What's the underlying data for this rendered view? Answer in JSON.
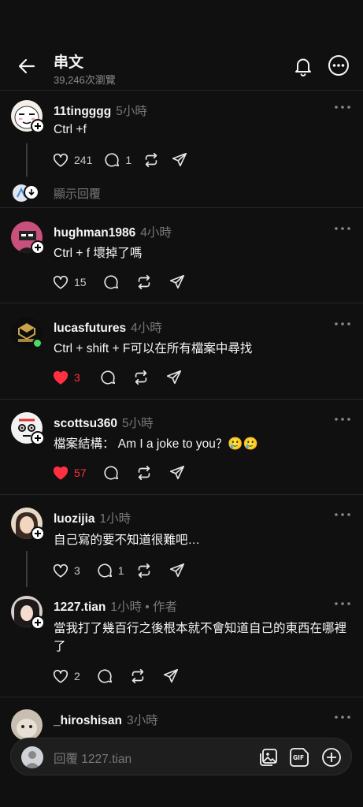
{
  "header": {
    "title": "串文",
    "views": "39,246次瀏覽"
  },
  "posts": [
    {
      "username": "11tingggg",
      "time": "5小時",
      "content": "Ctrl +f",
      "likes": "241",
      "replies": "1",
      "liked": false
    },
    {
      "username": "hughman1986",
      "time": "4小時",
      "content": "Ctrl + f 壞掉了嗎",
      "likes": "15",
      "replies": "",
      "liked": false
    },
    {
      "username": "lucasfutures",
      "time": "4小時",
      "content": "Ctrl + shift + F可以在所有檔案中尋找",
      "likes": "3",
      "replies": "",
      "liked": true
    },
    {
      "username": "scottsu360",
      "time": "5小時",
      "content": "檔案結構： Am I a joke to you？🥲🥲",
      "likes": "57",
      "replies": "",
      "liked": true
    },
    {
      "username": "luozijia",
      "time": "1小時",
      "content": "自己寫的要不知道很難吧…",
      "likes": "3",
      "replies": "1",
      "liked": false
    },
    {
      "username": "1227.tian",
      "time": "1小時 • 作者",
      "content": "當我打了幾百行之後根本就不會知道自己的東西在哪裡了",
      "likes": "2",
      "replies": "",
      "liked": false
    },
    {
      "username": "_hiroshisan",
      "time": "3小時",
      "content": "",
      "likes": "",
      "replies": "",
      "liked": false
    }
  ],
  "show_replies": "顯示回覆",
  "reply_bar": {
    "placeholder": "回覆 1227.tian"
  },
  "colors": {
    "background": "#101010",
    "text": "#f3f5f7",
    "muted": "#777777",
    "like_red": "#ff3040",
    "online_green": "#4cd964"
  }
}
